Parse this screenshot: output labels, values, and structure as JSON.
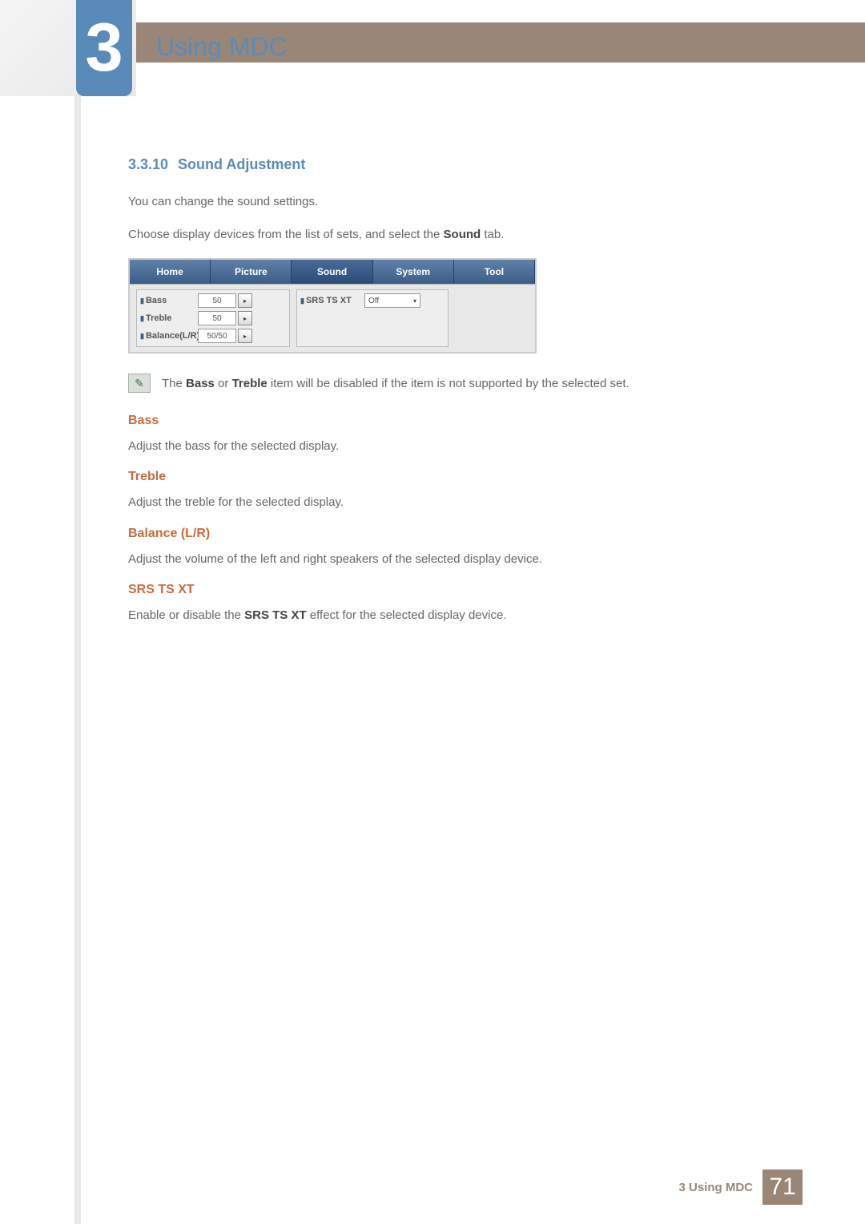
{
  "chapter": {
    "number": "3",
    "title": "Using MDC"
  },
  "section": {
    "number": "3.3.10",
    "title": "Sound Adjustment"
  },
  "intro_text1": "You can change the sound settings.",
  "intro_text2_a": "Choose display devices from the list of sets, and select the ",
  "intro_text2_b": "Sound",
  "intro_text2_c": " tab.",
  "screenshot": {
    "tabs": {
      "home": "Home",
      "picture": "Picture",
      "sound": "Sound",
      "system": "System",
      "tool": "Tool"
    },
    "controls": {
      "bass_label": "Bass",
      "bass_value": "50",
      "treble_label": "Treble",
      "treble_value": "50",
      "balance_label": "Balance(L/R)",
      "balance_value": "50/50",
      "srs_label": "SRS TS XT",
      "srs_value": "Off"
    }
  },
  "note_a": "The ",
  "note_b": "Bass",
  "note_c": " or ",
  "note_d": "Treble",
  "note_e": " item will be disabled if the item is not supported by the selected set.",
  "sub_bass": {
    "heading": "Bass",
    "text": "Adjust the bass for the selected display."
  },
  "sub_treble": {
    "heading": "Treble",
    "text": "Adjust the treble for the selected display."
  },
  "sub_balance": {
    "heading": "Balance (L/R)",
    "text": "Adjust the volume of the left and right speakers of the selected display device."
  },
  "sub_srs": {
    "heading": "SRS TS XT",
    "text_a": "Enable or disable the ",
    "text_b": "SRS TS XT",
    "text_c": " effect for the selected display device."
  },
  "footer": {
    "text": "3 Using MDC",
    "page": "71"
  }
}
